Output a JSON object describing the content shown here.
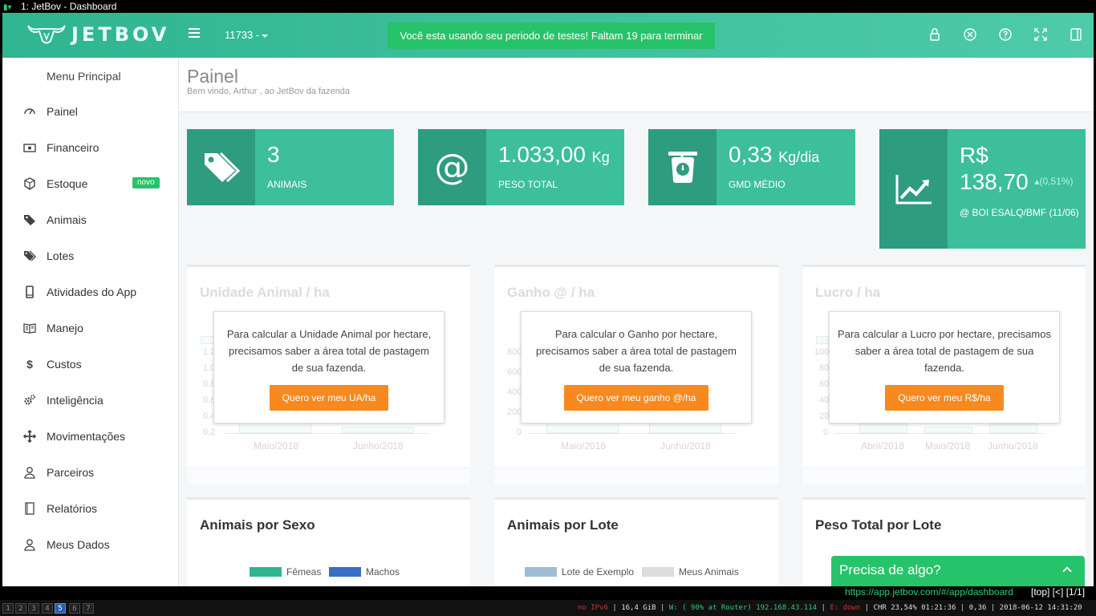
{
  "window": {
    "title": "1: JetBov - Dashboard"
  },
  "topbar": {
    "brand": "JETBOV",
    "farm_selector": "11733 -",
    "trial_notice": "Você esta usando seu periodo de testes! Faltam 19 para terminar"
  },
  "sidebar": {
    "heading": "Menu Principal",
    "items": [
      {
        "label": "Painel",
        "icon": "dashboard-icon"
      },
      {
        "label": "Financeiro",
        "icon": "money-icon"
      },
      {
        "label": "Estoque",
        "icon": "box-icon",
        "badge": "novo"
      },
      {
        "label": "Animais",
        "icon": "tag-icon"
      },
      {
        "label": "Lotes",
        "icon": "tags-icon"
      },
      {
        "label": "Atividades do App",
        "icon": "mobile-icon"
      },
      {
        "label": "Manejo",
        "icon": "book-icon"
      },
      {
        "label": "Custos",
        "icon": "dollar-icon"
      },
      {
        "label": "Inteligência",
        "icon": "gears-icon"
      },
      {
        "label": "Movimentações",
        "icon": "arrows-icon"
      },
      {
        "label": "Parceiros",
        "icon": "user-icon"
      },
      {
        "label": "Relatórios",
        "icon": "report-icon"
      },
      {
        "label": "Meus Dados",
        "icon": "user-icon"
      }
    ]
  },
  "page": {
    "title": "Painel",
    "subtitle": "Bem vindo, Arthur , ao JetBov da fazenda"
  },
  "stats": [
    {
      "value": "3",
      "unit": "",
      "label": "ANIMAIS",
      "icon": "tags-icon"
    },
    {
      "value": "1.033,00",
      "unit": "Kg",
      "label": "PESO TOTAL",
      "icon": "at-icon"
    },
    {
      "value": "0,33",
      "unit": "Kg/dia",
      "label": "GMD MÉDIO",
      "icon": "scale-icon"
    },
    {
      "value_line1": "R$",
      "value_line2": "138,70",
      "change": "(0,51%)",
      "label": "@ BOI ESALQ/BMF (11/06)",
      "icon": "line-chart-icon"
    }
  ],
  "panels_row1": [
    {
      "title": "Unidade Animal / ha",
      "message": "Para calcular a Unidade Animal por hectare, precisamos saber a área total de pastagem de sua fazenda.",
      "button": "Quero ver meu UA/ha",
      "ghost_y": [
        "1.2",
        "1.0",
        "0.8",
        "0.6",
        "0.4",
        "0.2"
      ],
      "ghost_x": [
        "Maio/2018",
        "Junho/2018"
      ]
    },
    {
      "title": "Ganho @ / ha",
      "message": "Para calcular o Ganho por hectare, precisamos saber a área total de pastagem de sua fazenda.",
      "button": "Quero ver meu ganho @/ha",
      "ghost_y": [
        "800",
        "600",
        "400",
        "200",
        "0"
      ],
      "ghost_x": [
        "Maio/2018",
        "Junho/2018"
      ]
    },
    {
      "title": "Lucro / ha",
      "message": "Para calcular a Lucro por hectare, precisamos saber a área total de pastagem de sua fazenda.",
      "button": "Quero ver meu R$/ha",
      "ghost_y": [
        "100",
        "80",
        "60",
        "40",
        "20",
        "0"
      ],
      "ghost_x": [
        "Abril/2018",
        "Maio/2018",
        "Junho/2018"
      ]
    }
  ],
  "panels_row2": [
    {
      "title": "Animais por Sexo",
      "legend": [
        {
          "label": "Fêmeas",
          "color": "#2fb58f"
        },
        {
          "label": "Machos",
          "color": "#3a6ec2"
        }
      ]
    },
    {
      "title": "Animais por Lote",
      "legend": [
        {
          "label": "Lote de Exemplo",
          "color": "#9fbcd3"
        },
        {
          "label": "Meus Animais",
          "color": "#dcdcdc"
        }
      ]
    },
    {
      "title": "Peso Total por Lote",
      "legend": []
    }
  ],
  "help": {
    "label": "Precisa de algo?"
  },
  "browser": {
    "url": "https://app.jetbov.com/#/app/dashboard",
    "tail": "[top] [<] [1/1]"
  },
  "statusbar": {
    "workspaces": [
      "1",
      "2",
      "3",
      "4",
      "5",
      "6",
      "7"
    ],
    "active_workspace": "5",
    "ipv6": "no IPv6",
    "disk": "16,4 GiB",
    "wifi": "W: ( 90% at Router) 192.168.43.114",
    "eth": "E: down",
    "battery": "CHR 23,54% 01:21:36",
    "load": "0,36",
    "datetime": "2018-06-12 14:31:20"
  }
}
